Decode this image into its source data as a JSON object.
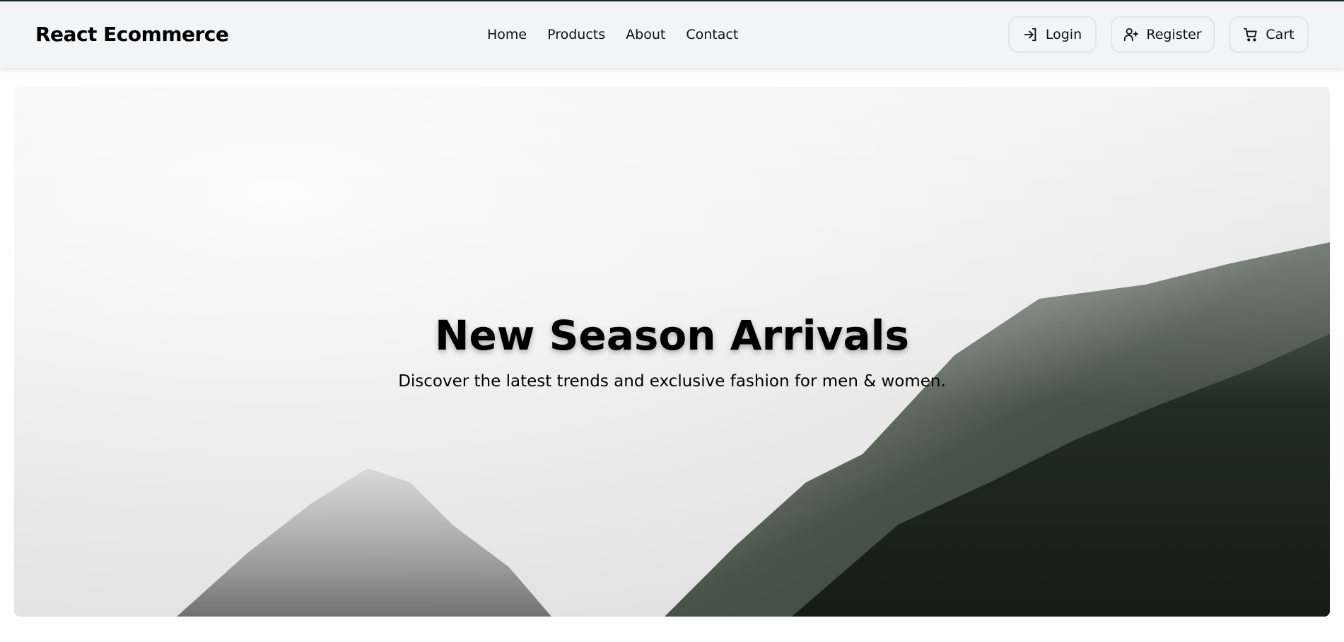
{
  "navbar": {
    "brand": "React Ecommerce",
    "links": [
      "Home",
      "Products",
      "About",
      "Contact"
    ],
    "buttons": {
      "login": {
        "label": "Login",
        "icon": "login-icon"
      },
      "register": {
        "label": "Register",
        "icon": "user-plus-icon"
      },
      "cart": {
        "label": "Cart",
        "icon": "cart-icon"
      }
    }
  },
  "hero": {
    "title": "New Season Arrivals",
    "subtitle": "Discover the latest trends and exclusive fashion for men & women."
  }
}
